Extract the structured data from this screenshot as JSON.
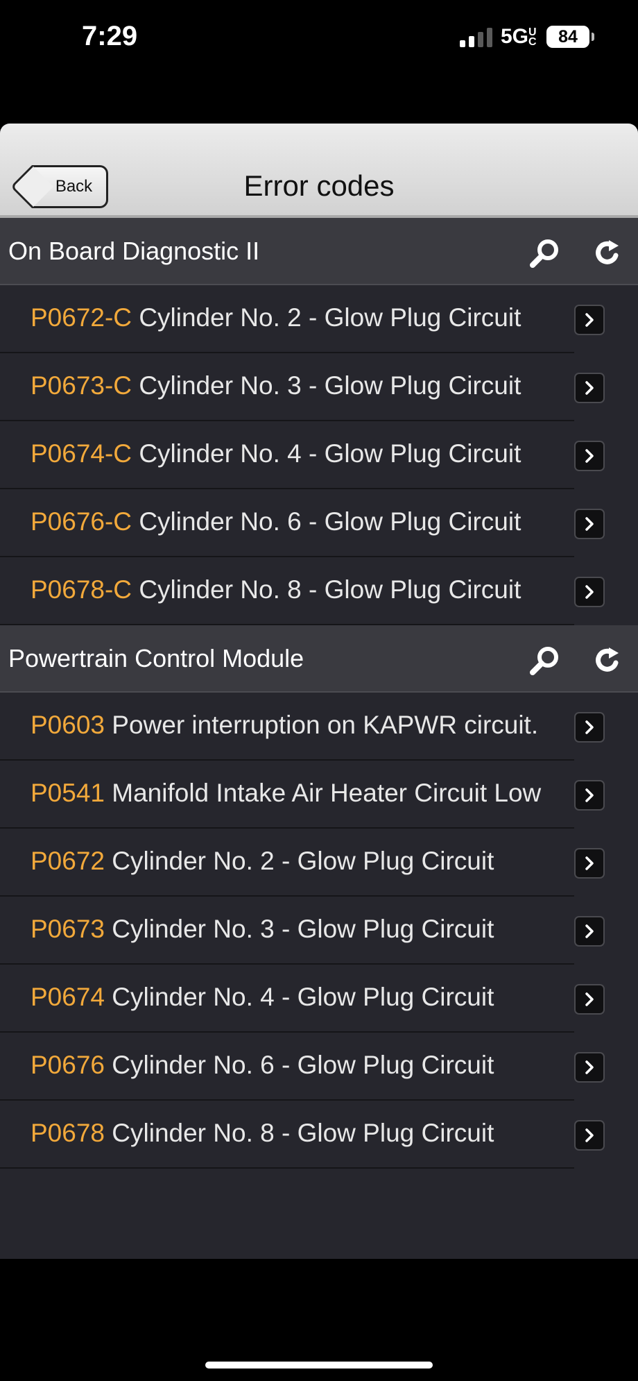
{
  "status": {
    "time": "7:29",
    "network": "5G",
    "network_suffix": "UC",
    "battery": "84"
  },
  "navbar": {
    "back_label": "Back",
    "title": "Error codes"
  },
  "sections": [
    {
      "label": "On Board Diagnostic II",
      "rows": [
        {
          "code": "P0672-C",
          "desc": "Cylinder No. 2 - Glow Plug Circuit"
        },
        {
          "code": "P0673-C",
          "desc": "Cylinder No. 3 - Glow Plug Circuit"
        },
        {
          "code": "P0674-C",
          "desc": "Cylinder No. 4 - Glow Plug Circuit"
        },
        {
          "code": "P0676-C",
          "desc": "Cylinder No. 6 - Glow Plug Circuit"
        },
        {
          "code": "P0678-C",
          "desc": "Cylinder No. 8 - Glow Plug Circuit"
        }
      ]
    },
    {
      "label": "Powertrain Control Module",
      "rows": [
        {
          "code": "P0603",
          "desc": "Power interruption on KAPWR circuit."
        },
        {
          "code": "P0541",
          "desc": "Manifold Intake Air Heater Circuit Low"
        },
        {
          "code": "P0672",
          "desc": "Cylinder No. 2 - Glow Plug Circuit"
        },
        {
          "code": "P0673",
          "desc": "Cylinder No. 3 - Glow Plug Circuit"
        },
        {
          "code": "P0674",
          "desc": "Cylinder No. 4 - Glow Plug Circuit"
        },
        {
          "code": "P0676",
          "desc": "Cylinder No. 6 - Glow Plug Circuit"
        },
        {
          "code": "P0678",
          "desc": "Cylinder No. 8 - Glow Plug Circuit"
        }
      ]
    }
  ],
  "toolbar": {
    "icons": [
      "scan-icon",
      "rescan-icon",
      "share-icon",
      "trash-icon"
    ]
  },
  "colors": {
    "code": "#f2a93b",
    "list_bg": "#26262d",
    "section_bg": "#3a3a40"
  }
}
